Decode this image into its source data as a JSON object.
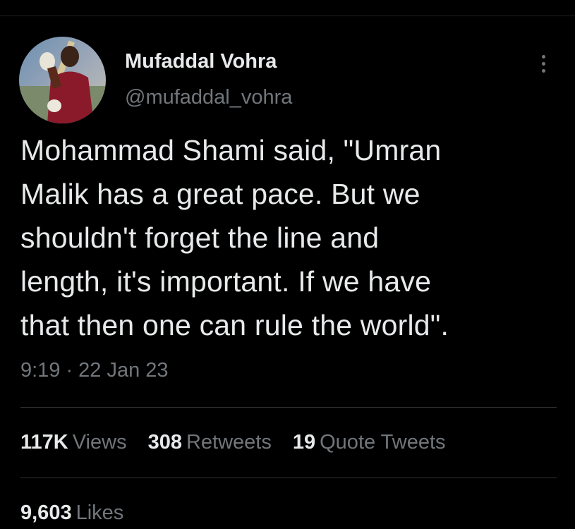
{
  "tweet": {
    "author": {
      "name": "Mufaddal Vohra",
      "handle": "@mufaddal_vohra"
    },
    "text_lines": [
      "Mohammad Shami said, \"Umran",
      "Malik has a great pace. But we",
      "shouldn't forget the line and",
      "length, it's important. If we have",
      "that then one can rule the world\"."
    ],
    "time": "9:19",
    "separator": "·",
    "date": "22 Jan 23",
    "stats": {
      "views": {
        "count": "117K",
        "label": "Views"
      },
      "retweets": {
        "count": "308",
        "label": "Retweets"
      },
      "quotes": {
        "count": "19",
        "label": "Quote Tweets"
      },
      "likes": {
        "count": "9,603",
        "label": "Likes"
      }
    }
  },
  "icons": {
    "more": "more-vertical-icon"
  },
  "colors": {
    "background": "#000000",
    "primary_text": "#e7e9ea",
    "secondary_text": "#71767b",
    "divider": "#2f3336"
  }
}
